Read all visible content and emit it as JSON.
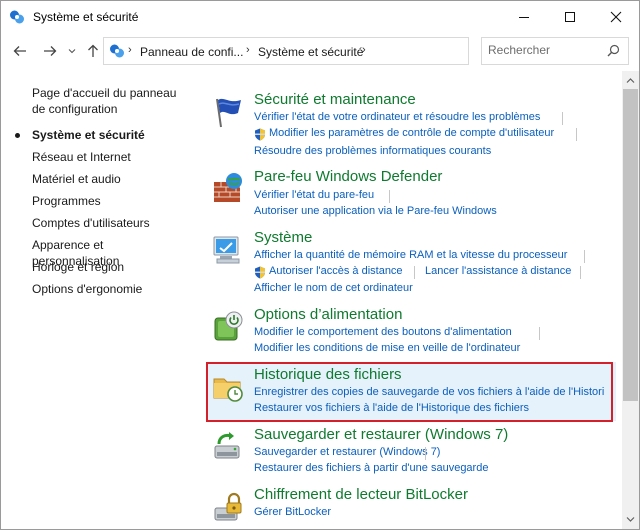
{
  "window": {
    "title": "Système et sécurité",
    "icons": {
      "app": "control-panel-icon",
      "minimize": "minimize-icon",
      "maximize": "maximize-icon",
      "close": "close-icon"
    }
  },
  "navigation": {
    "breadcrumbs": [
      "Panneau de confi...",
      "Système et sécurité"
    ],
    "search_placeholder": "Rechercher",
    "icons": [
      "back-arrow-icon",
      "forward-arrow-icon",
      "recent-pages-chevron-icon",
      "up-arrow-icon",
      "refresh-icon",
      "search-icon"
    ]
  },
  "sidebar": {
    "items": [
      {
        "label": "Page d'accueil du panneau de configuration",
        "active": false
      },
      {
        "label": "Système et sécurité",
        "active": true
      },
      {
        "label": "Réseau et Internet",
        "active": false
      },
      {
        "label": "Matériel et audio",
        "active": false
      },
      {
        "label": "Programmes",
        "active": false
      },
      {
        "label": "Comptes d'utilisateurs",
        "active": false
      },
      {
        "label": "Apparence et personnalisation",
        "active": false
      },
      {
        "label": "Horloge et région",
        "active": false
      },
      {
        "label": "Options d'ergonomie",
        "active": false
      }
    ]
  },
  "categories": [
    {
      "title": "Sécurité et maintenance",
      "icon": "flag-icon",
      "links": [
        "Vérifier l'état de votre ordinateur et résoudre les problèmes",
        "Modifier les paramètres de contrôle de compte d'utilisateur",
        "Résoudre des problèmes informatiques courants"
      ]
    },
    {
      "title": "Pare-feu Windows Defender",
      "icon": "firewall-icon",
      "links": [
        "Vérifier l'état du pare-feu",
        "Autoriser une application via le Pare-feu Windows"
      ]
    },
    {
      "title": "Système",
      "icon": "computer-icon",
      "links": [
        "Afficher la quantité de mémoire RAM et la vitesse du processeur",
        "Autoriser l'accès à distance",
        "Lancer l'assistance à distance",
        "Afficher le nom de cet ordinateur"
      ]
    },
    {
      "title": "Options d’alimentation",
      "icon": "power-battery-icon",
      "links": [
        "Modifier le comportement des boutons d'alimentation",
        "Modifier les conditions de mise en veille de l'ordinateur"
      ]
    },
    {
      "title": "Historique des fichiers",
      "icon": "file-history-icon",
      "highlighted": true,
      "links": [
        "Enregistrer des copies de sauvegarde de vos fichiers à l'aide de l'Histori",
        "Restaurer vos fichiers à l'aide de l'Historique des fichiers"
      ]
    },
    {
      "title": "Sauvegarder et restaurer (Windows 7)",
      "icon": "backup-restore-icon",
      "links": [
        "Sauvegarder et restaurer (Windows 7)",
        "Restaurer des fichiers à partir d'une sauvegarde"
      ]
    },
    {
      "title": "Chiffrement de lecteur BitLocker",
      "icon": "bitlocker-icon",
      "links": [
        "Gérer BitLocker"
      ]
    }
  ],
  "colors": {
    "category_title": "#0f7a2f",
    "link": "#0b5fbd",
    "highlight_background": "#e5f1fb",
    "highlight_border": "#d3202a",
    "uac_shield": "#1f5fbf"
  }
}
